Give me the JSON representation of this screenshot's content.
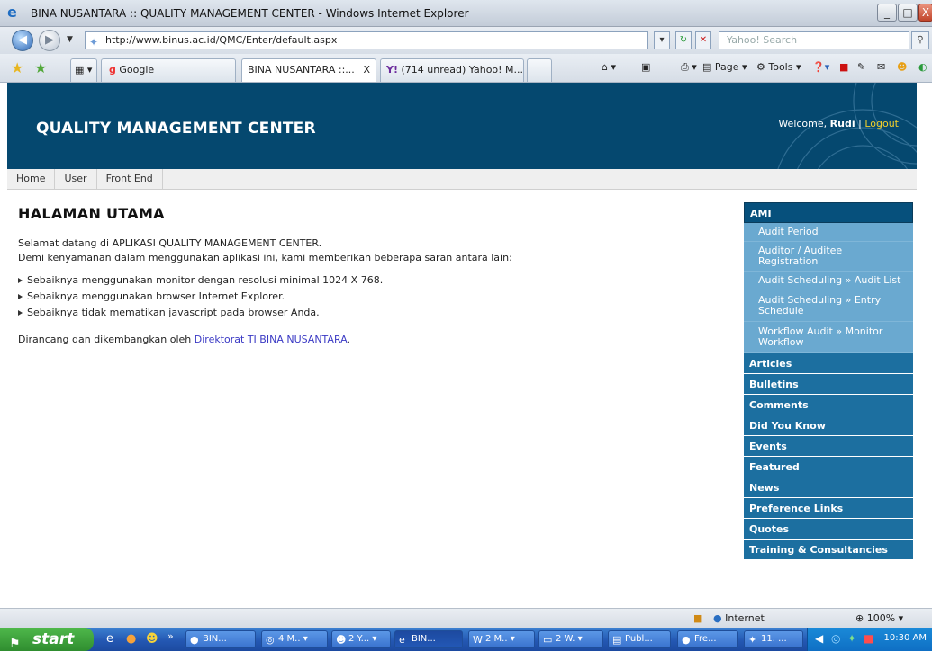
{
  "window": {
    "title": "BINA NUSANTARA :: QUALITY MANAGEMENT CENTER - Windows Internet Explorer",
    "minimize": "_",
    "restore": "□",
    "close": "X"
  },
  "addressbar": {
    "url": "http://www.binus.ac.id/QMC/Enter/default.aspx",
    "search_placeholder": "Yahoo! Search"
  },
  "tabs": {
    "google_label": "Google",
    "tab1_label": "BINA NUSANTARA ::...",
    "tab1_close": "X",
    "tab2_label": "(714 unread) Yahoo! M...",
    "page_label": "Page",
    "tools_label": "Tools"
  },
  "page": {
    "site_title": "QUALITY MANAGEMENT CENTER",
    "welcome_prefix": "Welcome,",
    "username": "Rudi",
    "separator": "|",
    "logout": "Logout",
    "menu": [
      "Home",
      "User",
      "Front End"
    ],
    "heading": "HALAMAN UTAMA",
    "intro_line1": "Selamat datang di APLIKASI QUALITY MANAGEMENT CENTER.",
    "intro_line2": "Demi kenyamanan dalam menggunakan aplikasi ini, kami memberikan beberapa saran antara lain:",
    "tips": [
      "Sebaiknya menggunakan monitor dengan resolusi minimal 1024 X 768.",
      "Sebaiknya menggunakan browser Internet Explorer.",
      "Sebaiknya tidak mematikan javascript pada browser Anda."
    ],
    "credit_prefix": "Dirancang dan dikembangkan oleh",
    "credit_link": "Direktorat TI BINA NUSANTARA",
    "credit_suffix": "."
  },
  "sidebar": {
    "ami_title": "AMI",
    "ami_items": [
      "Audit Period",
      "Auditor / Auditee Registration",
      "Audit Scheduling » Audit List",
      "Audit Scheduling » Entry Schedule",
      "Workflow Audit » Monitor Workflow"
    ],
    "sections": [
      "Articles",
      "Bulletins",
      "Comments",
      "Did You Know",
      "Events",
      "Featured",
      "News",
      "Preference Links",
      "Quotes",
      "Training & Consultancies"
    ]
  },
  "statusbar": {
    "zone": "Internet",
    "zoom": "100%"
  },
  "taskbar": {
    "start": "start",
    "items": [
      "BIN...",
      "4 M..",
      "2 Y...",
      "BIN...",
      "2 M..",
      "2 W.",
      "Publ...",
      "Fre...",
      "11. ..."
    ],
    "clock": "10:30 AM"
  },
  "colors": {
    "header_bg": "#05486f",
    "sidebar_head": "#1c6fa0",
    "sidebar_sub": "#6aa9d0",
    "link": "#3a39c4",
    "logout": "#f2d02b"
  }
}
